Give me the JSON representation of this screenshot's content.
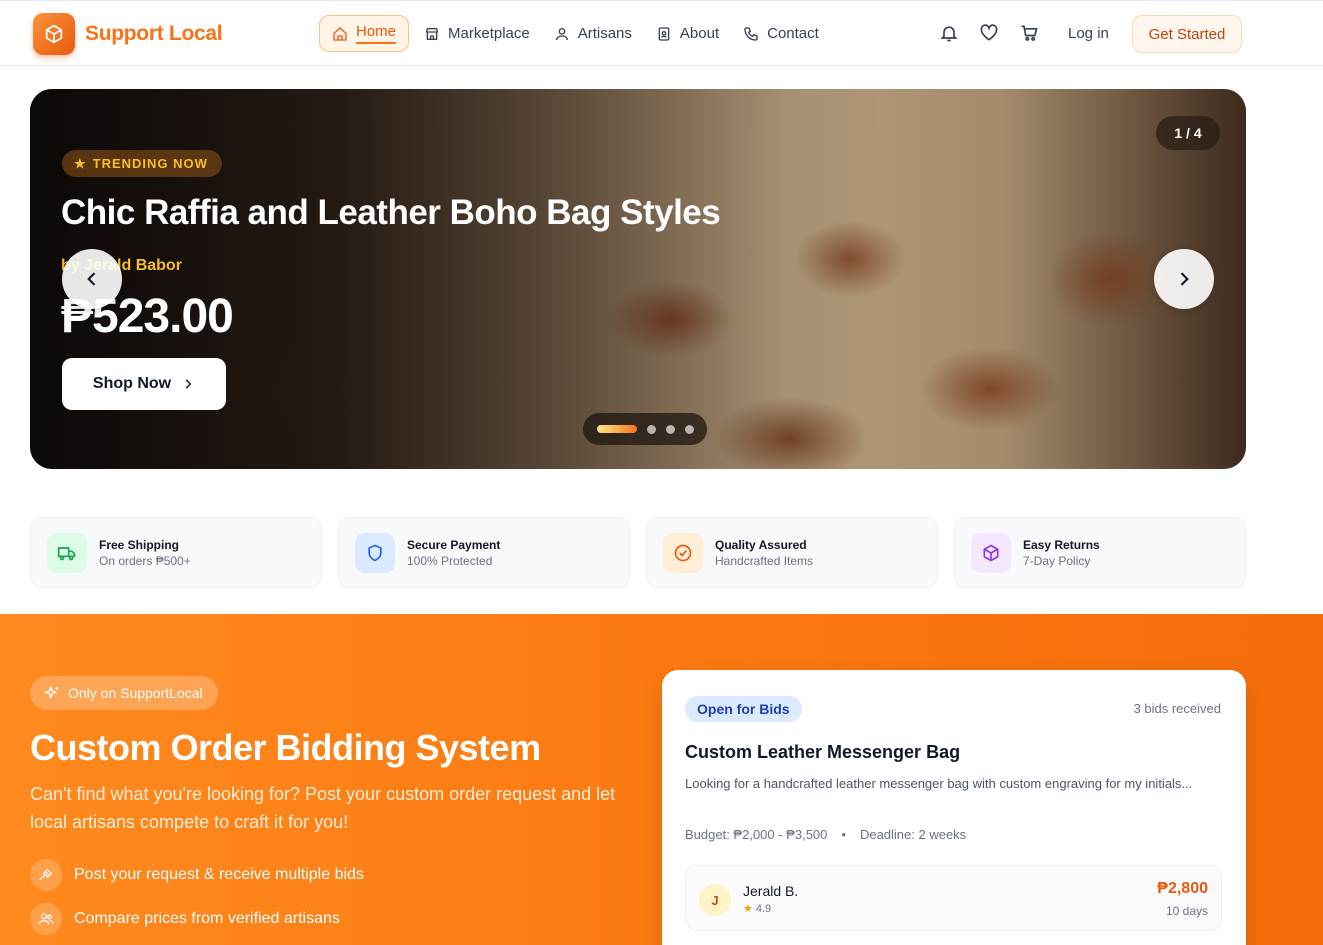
{
  "brand": {
    "name": "Support Local"
  },
  "nav": {
    "items": [
      {
        "label": "Home",
        "icon": "home-icon",
        "active": true
      },
      {
        "label": "Marketplace",
        "icon": "store-icon"
      },
      {
        "label": "Artisans",
        "icon": "user-icon"
      },
      {
        "label": "About",
        "icon": "id-badge-icon"
      },
      {
        "label": "Contact",
        "icon": "phone-icon"
      }
    ],
    "login": "Log in",
    "cta": "Get Started"
  },
  "hero": {
    "tag": "TRENDING NOW",
    "title": "Chic Raffia and Leather Boho Bag Styles",
    "artisan": "by Jerald Babor",
    "price": "₱523.00",
    "button": "Shop Now",
    "slide_counter": "1 / 4",
    "slides_total": 4,
    "active_slide": 1
  },
  "features": [
    {
      "title": "Free Shipping",
      "subtitle": "On orders ₱500+",
      "icon": "truck-icon",
      "color": "#16a34a",
      "bg": "#dcfce7"
    },
    {
      "title": "Secure Payment",
      "subtitle": "100% Protected",
      "icon": "shield-icon",
      "color": "#2563eb",
      "bg": "#dbeafe"
    },
    {
      "title": "Quality Assured",
      "subtitle": "Handcrafted Items",
      "icon": "check-circle-icon",
      "color": "#ea580c",
      "bg": "#ffedd5"
    },
    {
      "title": "Easy Returns",
      "subtitle": "7-Day Policy",
      "icon": "package-icon",
      "color": "#9333ea",
      "bg": "#f3e8ff"
    }
  ],
  "bidding": {
    "badge": "Only on SupportLocal",
    "title": "Custom Order Bidding System",
    "description": "Can't find what you're looking for? Post your custom order request and let local artisans compete to craft it for you!",
    "bullets": [
      {
        "text": "Post your request & receive multiple bids",
        "icon": "gavel-icon"
      },
      {
        "text": "Compare prices from verified artisans",
        "icon": "users-icon"
      }
    ],
    "card": {
      "status": "Open for Bids",
      "bids_received": "3 bids received",
      "title": "Custom Leather Messenger Bag",
      "description": "Looking for a handcrafted leather messenger bag with custom engraving for my initials...",
      "budget": "Budget: ₱2,000 - ₱3,500",
      "separator": "•",
      "deadline": "Deadline: 2 weeks",
      "bid": {
        "initial": "J",
        "name": "Jerald B.",
        "rating": "4.9",
        "price": "₱2,800",
        "days": "10 days"
      }
    }
  },
  "colors": {
    "accent": "#f97316",
    "accent_dark": "#ea580c",
    "gold": "#fbbf24"
  }
}
